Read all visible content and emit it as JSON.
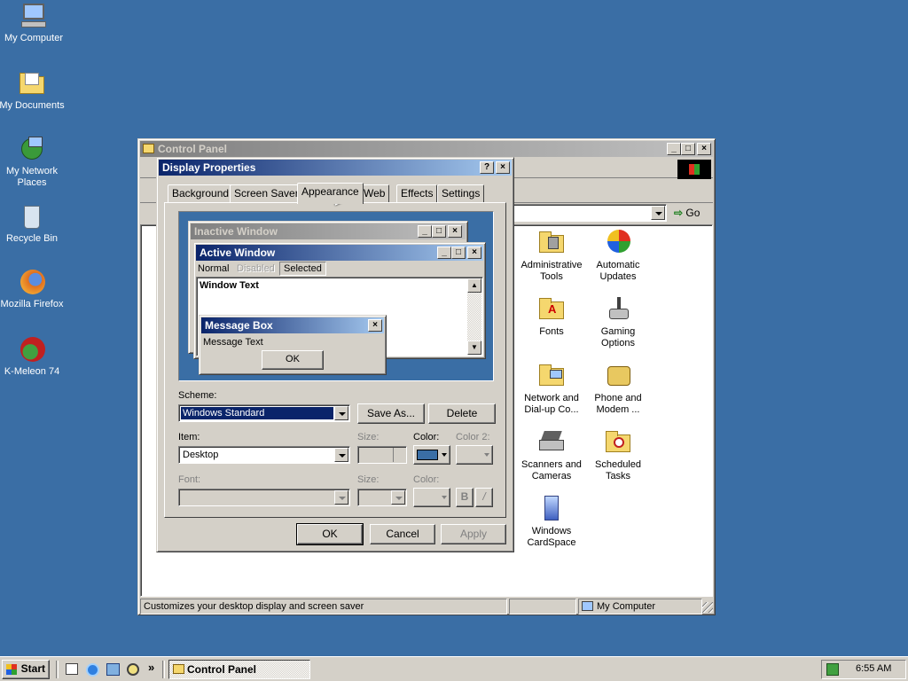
{
  "desktop": {
    "icons": [
      {
        "label": "My Computer",
        "icon": "computer-icon"
      },
      {
        "label": "My Documents",
        "icon": "documents-icon"
      },
      {
        "label": "My Network Places",
        "icon": "network-icon"
      },
      {
        "label": "Recycle Bin",
        "icon": "recycle-bin-icon"
      },
      {
        "label": "Mozilla Firefox",
        "icon": "firefox-icon"
      },
      {
        "label": "K-Meleon 74",
        "icon": "kmeleon-icon"
      }
    ]
  },
  "control_panel": {
    "title": "Control Panel",
    "go_label": "Go",
    "status_text": "Customizes your desktop display and screen saver",
    "status_zone": "My Computer",
    "items": [
      {
        "label": "Administrative Tools",
        "icon": "admin-tools-icon"
      },
      {
        "label": "Automatic Updates",
        "icon": "windows-update-icon"
      },
      {
        "label": "Fonts",
        "icon": "fonts-icon"
      },
      {
        "label": "Gaming Options",
        "icon": "joystick-icon"
      },
      {
        "label": "Network and Dial-up Co...",
        "icon": "network-connections-icon"
      },
      {
        "label": "Phone and Modem ...",
        "icon": "phone-icon"
      },
      {
        "label": "Scanners and Cameras",
        "icon": "scanner-icon"
      },
      {
        "label": "Scheduled Tasks",
        "icon": "scheduled-tasks-icon"
      },
      {
        "label": "Windows CardSpace",
        "icon": "cardspace-icon"
      }
    ]
  },
  "display_properties": {
    "title": "Display Properties",
    "tabs": [
      "Background",
      "Screen Saver",
      "Appearance",
      "Web",
      "Effects",
      "Settings"
    ],
    "active_tab": "Appearance",
    "preview": {
      "inactive_title": "Inactive Window",
      "active_title": "Active Window",
      "menu": [
        "Normal",
        "Disabled",
        "Selected"
      ],
      "window_text": "Window Text",
      "msgbox_title": "Message Box",
      "msgbox_text": "Message Text",
      "msgbox_ok": "OK"
    },
    "scheme_label": "Scheme:",
    "scheme_value": "Windows Standard",
    "save_as": "Save As...",
    "delete": "Delete",
    "item_label": "Item:",
    "item_value": "Desktop",
    "size_label": "Size:",
    "color_label": "Color:",
    "color2_label": "Color 2:",
    "font_label": "Font:",
    "font_size_label": "Size:",
    "font_color_label": "Color:",
    "bold": "B",
    "italic": "/",
    "ok": "OK",
    "cancel": "Cancel",
    "apply": "Apply",
    "desktop_color": "#3a6ea5"
  },
  "taskbar": {
    "start": "Start",
    "task": "Control Panel",
    "time": "6:55 AM",
    "chevron": "»"
  }
}
